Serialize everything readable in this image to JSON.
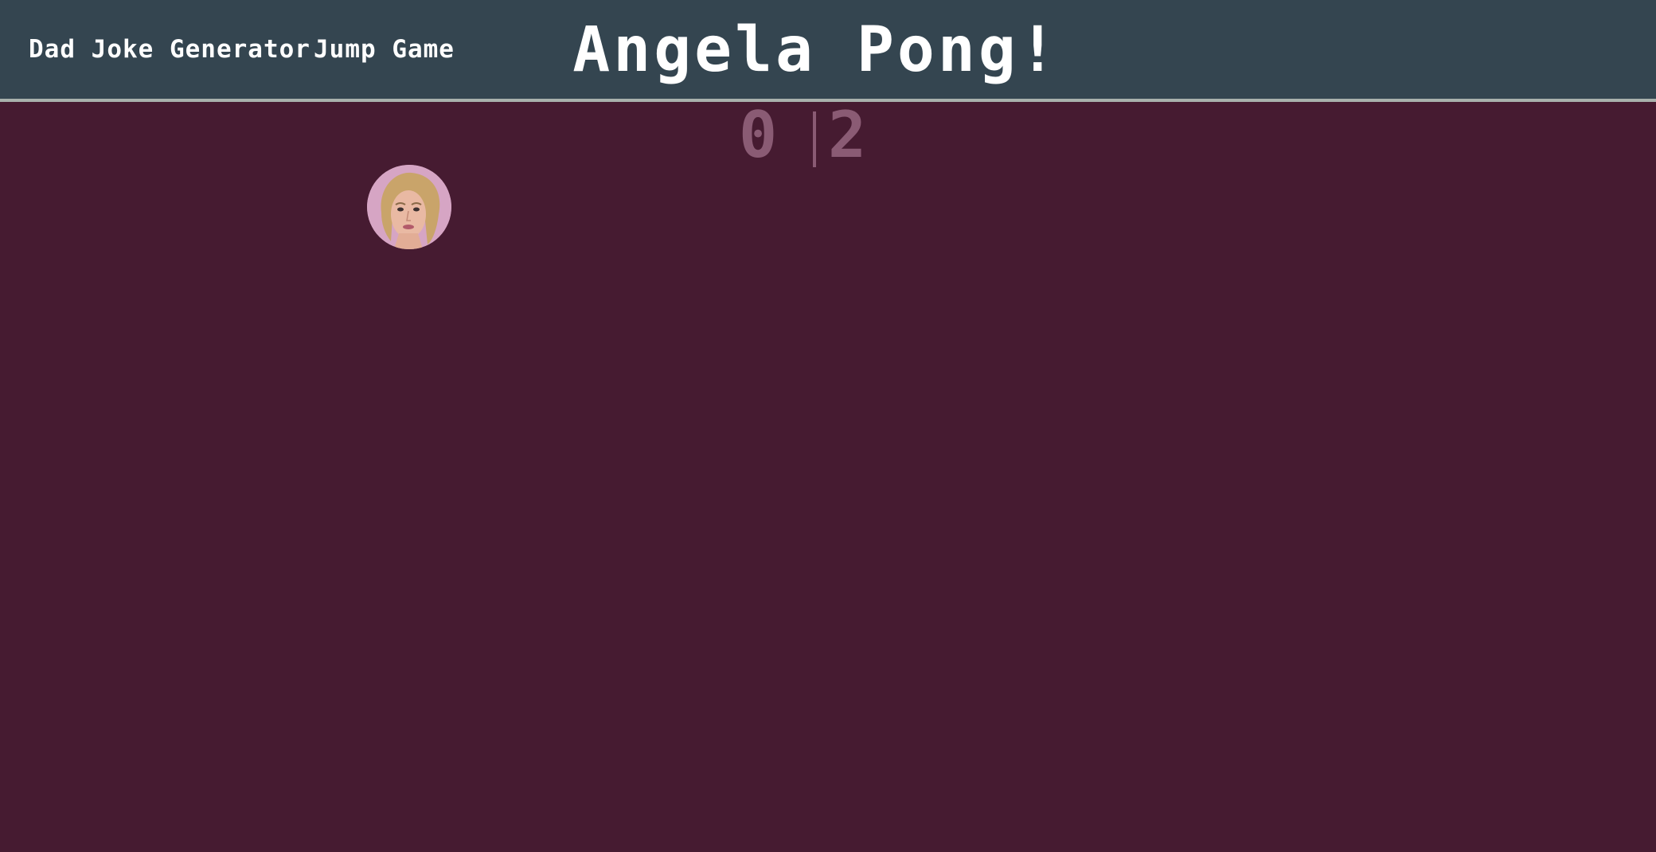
{
  "nav": {
    "dad_joke": "Dad Joke Generator",
    "jump_game": "Jump Game"
  },
  "title": "Angela Pong!",
  "score": {
    "left": "0",
    "right": "2"
  },
  "ball": {
    "icon": "angela-face-ball"
  },
  "colors": {
    "header_bg": "#344550",
    "game_bg": "#461b31",
    "score": "#8a5b74",
    "header_border": "#a9b1ad"
  }
}
